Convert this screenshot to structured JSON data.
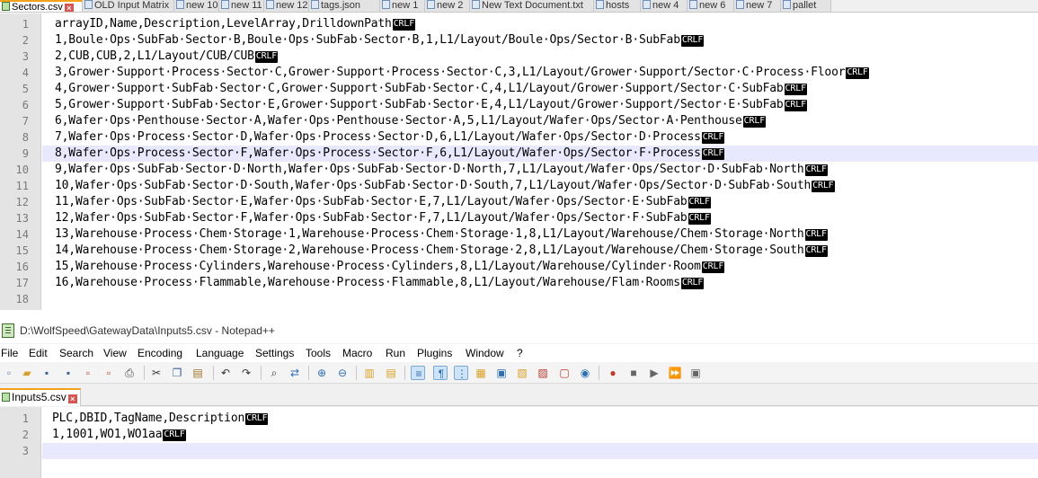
{
  "top_tabs": [
    {
      "label": "Sectors.csv",
      "active": true
    },
    {
      "label": "OLD Input Matrix"
    },
    {
      "label": "new 10"
    },
    {
      "label": "new 11"
    },
    {
      "label": "new 12"
    },
    {
      "label": "tags.json"
    },
    {
      "label": "new 1"
    },
    {
      "label": "new 2"
    },
    {
      "label": "New Text Document.txt"
    },
    {
      "label": "hosts"
    },
    {
      "label": "new 4"
    },
    {
      "label": "new 6"
    },
    {
      "label": "new 7"
    },
    {
      "label": "pallet"
    }
  ],
  "top_editor": {
    "lines": [
      {
        "n": "1",
        "text": "arrayID,Name,Description,LevelArray,DrilldownPath"
      },
      {
        "n": "2",
        "text": "1,Boule·Ops·SubFab·Sector·B,Boule·Ops·SubFab·Sector·B,1,L1/Layout/Boule·Ops/Sector·B·SubFab"
      },
      {
        "n": "3",
        "text": "2,CUB,CUB,2,L1/Layout/CUB/CUB"
      },
      {
        "n": "4",
        "text": "3,Grower·Support·Process·Sector·C,Grower·Support·Process·Sector·C,3,L1/Layout/Grower·Support/Sector·C·Process·Floor"
      },
      {
        "n": "5",
        "text": "4,Grower·Support·SubFab·Sector·C,Grower·Support·SubFab·Sector·C,4,L1/Layout/Grower·Support/Sector·C·SubFab"
      },
      {
        "n": "6",
        "text": "5,Grower·Support·SubFab·Sector·E,Grower·Support·SubFab·Sector·E,4,L1/Layout/Grower·Support/Sector·E·SubFab"
      },
      {
        "n": "7",
        "text": "6,Wafer·Ops·Penthouse·Sector·A,Wafer·Ops·Penthouse·Sector·A,5,L1/Layout/Wafer·Ops/Sector·A·Penthouse"
      },
      {
        "n": "8",
        "text": "7,Wafer·Ops·Process·Sector·D,Wafer·Ops·Process·Sector·D,6,L1/Layout/Wafer·Ops/Sector·D·Process"
      },
      {
        "n": "9",
        "text": "8,Wafer·Ops·Process·Sector·F,Wafer·Ops·Process·Sector·F,6,L1/Layout/Wafer·Ops/Sector·F·Process",
        "current": true
      },
      {
        "n": "10",
        "text": "9,Wafer·Ops·SubFab·Sector·D·North,Wafer·Ops·SubFab·Sector·D·North,7,L1/Layout/Wafer·Ops/Sector·D·SubFab·North"
      },
      {
        "n": "11",
        "text": "10,Wafer·Ops·SubFab·Sector·D·South,Wafer·Ops·SubFab·Sector·D·South,7,L1/Layout/Wafer·Ops/Sector·D·SubFab·South"
      },
      {
        "n": "12",
        "text": "11,Wafer·Ops·SubFab·Sector·E,Wafer·Ops·SubFab·Sector·E,7,L1/Layout/Wafer·Ops/Sector·E·SubFab"
      },
      {
        "n": "13",
        "text": "12,Wafer·Ops·SubFab·Sector·F,Wafer·Ops·SubFab·Sector·F,7,L1/Layout/Wafer·Ops/Sector·F·SubFab"
      },
      {
        "n": "14",
        "text": "13,Warehouse·Process·Chem·Storage·1,Warehouse·Process·Chem·Storage·1,8,L1/Layout/Warehouse/Chem·Storage·North"
      },
      {
        "n": "15",
        "text": "14,Warehouse·Process·Chem·Storage·2,Warehouse·Process·Chem·Storage·2,8,L1/Layout/Warehouse/Chem·Storage·South"
      },
      {
        "n": "16",
        "text": "15,Warehouse·Process·Cylinders,Warehouse·Process·Cylinders,8,L1/Layout/Warehouse/Cylinder·Room"
      },
      {
        "n": "17",
        "text": "16,Warehouse·Process·Flammable,Warehouse·Process·Flammable,8,L1/Layout/Warehouse/Flam·Rooms"
      },
      {
        "n": "18",
        "text": "",
        "no_eol": true
      }
    ]
  },
  "eol_marker": "CRLF",
  "window2": {
    "title": "D:\\WolfSpeed\\GatewayData\\Inputs5.csv - Notepad++",
    "menu": [
      "File",
      "Edit",
      "Search",
      "View",
      "Encoding",
      "Language",
      "Settings",
      "Tools",
      "Macro",
      "Run",
      "Plugins",
      "Window",
      "?"
    ],
    "toolbar_icons": [
      "new-file-icon",
      "open-file-icon",
      "save-icon",
      "save-all-icon",
      "close-icon",
      "close-all-icon",
      "print-icon",
      "cut-icon",
      "copy-icon",
      "paste-icon",
      "undo-icon",
      "redo-icon",
      "find-icon",
      "replace-icon",
      "zoom-in-icon",
      "zoom-out-icon",
      "sync-vertical-icon",
      "sync-horizontal-icon",
      "word-wrap-icon",
      "show-all-characters-icon",
      "indent-guide-icon",
      "document-map-icon",
      "function-list-icon",
      "folder-as-workspace-icon",
      "monitoring-icon",
      "document-list-icon",
      "eye-icon",
      "record-macro-icon",
      "stop-record-icon",
      "play-macro-icon",
      "run-macro-multiple-icon",
      "save-macro-icon"
    ],
    "tabs": [
      {
        "label": "Inputs5.csv",
        "active": true
      }
    ],
    "lines": [
      {
        "n": "1",
        "text": "PLC,DBID,TagName,Description"
      },
      {
        "n": "2",
        "text": "1,1001,WO1,WO1aa"
      },
      {
        "n": "3",
        "text": "",
        "no_eol": true,
        "current": true
      }
    ]
  }
}
